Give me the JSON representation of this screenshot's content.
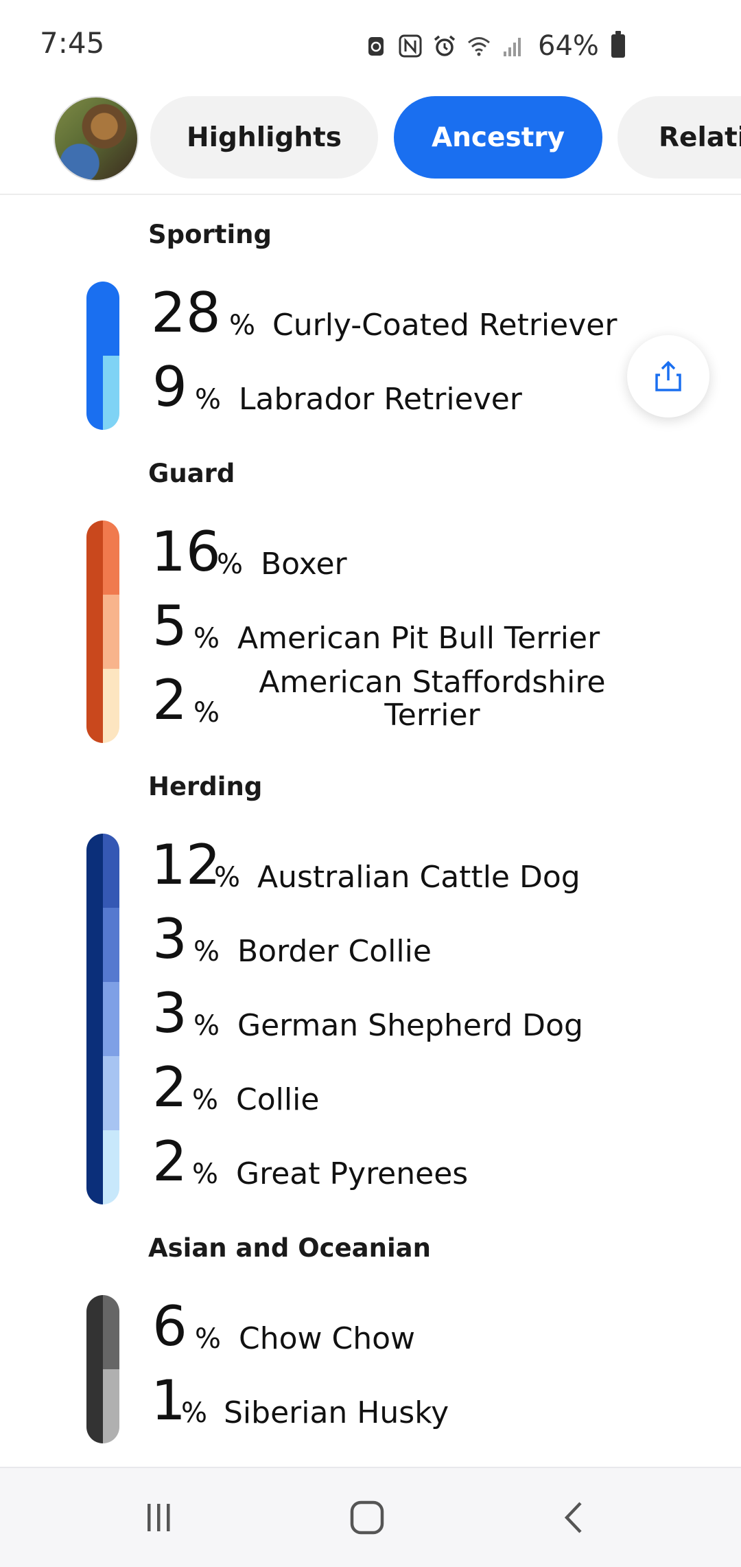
{
  "status_bar": {
    "time": "7:45",
    "battery": "64%",
    "icons": [
      "recycle-icon",
      "nfc-icon",
      "alarm-icon",
      "wifi-icon",
      "signal-icon",
      "battery-icon"
    ]
  },
  "tabs": [
    {
      "label": "Highlights",
      "active": false
    },
    {
      "label": "Ancestry",
      "active": true
    },
    {
      "label": "Relati",
      "active": false
    }
  ],
  "groups": [
    {
      "name": "Sporting",
      "color_dark": "#1a6ff0",
      "breeds": [
        {
          "percent": "28",
          "name": "Curly-Coated Retriever",
          "color": "#1a6ff0"
        },
        {
          "percent": "9",
          "name": "Labrador Retriever",
          "color": "#7fd3f5"
        }
      ]
    },
    {
      "name": "Guard",
      "color_dark": "#c9481d",
      "breeds": [
        {
          "percent": "16",
          "name": "Boxer",
          "color": "#f07a4e"
        },
        {
          "percent": "5",
          "name": "American Pit Bull Terrier",
          "color": "#f8b48c"
        },
        {
          "percent": "2",
          "name": "American Staffordshire Terrier",
          "color": "#fde5c0"
        }
      ]
    },
    {
      "name": "Herding",
      "color_dark": "#0b2f7a",
      "breeds": [
        {
          "percent": "12",
          "name": "Australian Cattle Dog",
          "color": "#3558b4"
        },
        {
          "percent": "3",
          "name": "Border Collie",
          "color": "#5579cf"
        },
        {
          "percent": "3",
          "name": "German Shepherd Dog",
          "color": "#7ea0e6"
        },
        {
          "percent": "2",
          "name": "Collie",
          "color": "#a7c4f2"
        },
        {
          "percent": "2",
          "name": "Great Pyrenees",
          "color": "#c8e8fb"
        }
      ]
    },
    {
      "name": "Asian and Oceanian",
      "color_dark": "#333333",
      "breeds": [
        {
          "percent": "6",
          "name": "Chow Chow",
          "color": "#666666"
        },
        {
          "percent": "1",
          "name": "Siberian Husky",
          "color": "#b0b0b0"
        }
      ]
    }
  ],
  "percent_sign": "%",
  "share": {
    "icon": "share-icon"
  },
  "nav": {
    "icons": [
      "recent-apps-icon",
      "home-icon",
      "back-icon"
    ]
  },
  "colors": {
    "accent": "#1a6ff0"
  }
}
